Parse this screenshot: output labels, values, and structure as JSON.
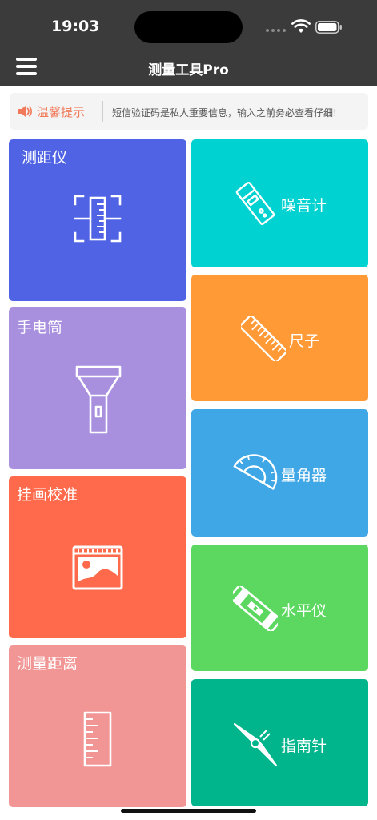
{
  "status_bar": {
    "time": "19:03"
  },
  "header": {
    "title": "测量工具Pro",
    "menu_icon": "hamburger-menu-icon"
  },
  "notice": {
    "label": "温馨提示",
    "message": "短信验证码是私人重要信息，输入之前务必查看仔细!",
    "label_color": "#f07a5a",
    "icon": "speaker-icon"
  },
  "tiles": {
    "rangefinder": {
      "label": "测距仪",
      "color": "#4f63e4",
      "icon": "rangefinder-icon"
    },
    "flashlight": {
      "label": "手电筒",
      "color": "#a890df",
      "icon": "flashlight-icon"
    },
    "picture_hanging": {
      "label": "挂画校准",
      "color": "#fe6a4b",
      "icon": "picture-icon"
    },
    "measure_distance": {
      "label": "测量距离",
      "color": "#f19595",
      "icon": "ruler-vertical-icon"
    },
    "noise_meter": {
      "label": "噪音计",
      "color": "#00d2d2",
      "icon": "noise-meter-icon"
    },
    "ruler": {
      "label": "尺子",
      "color": "#ff9a37",
      "icon": "ruler-icon"
    },
    "protractor": {
      "label": "量角器",
      "color": "#3fa7e6",
      "icon": "protractor-icon"
    },
    "level": {
      "label": "水平仪",
      "color": "#5cd861",
      "icon": "spirit-level-icon"
    },
    "compass": {
      "label": "指南针",
      "color": "#00b48b",
      "icon": "compass-icon"
    }
  }
}
